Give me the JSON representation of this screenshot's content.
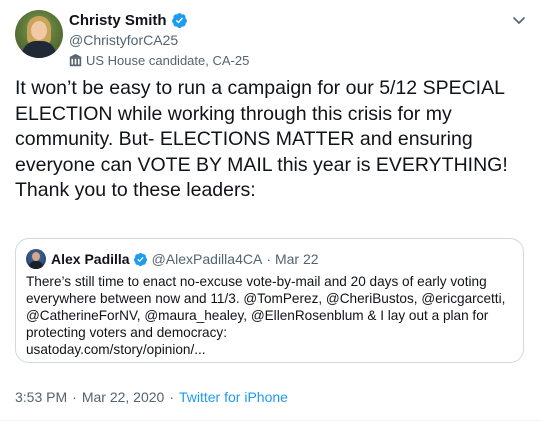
{
  "author": {
    "display_name": "Christy Smith",
    "handle": "@ChristyforCA25",
    "label": "US House candidate, CA-25",
    "verified": true
  },
  "tweet": {
    "lines": [
      "It won’t be easy to run a campaign for our 5/12 SPECIAL",
      "ELECTION while working through this crisis for my",
      "community.  But- ELECTIONS MATTER and ensuring",
      "everyone can VOTE BY MAIL this year is EVERYTHING!",
      "Thank you to these leaders:"
    ]
  },
  "quoted_tweet": {
    "display_name": "Alex Padilla",
    "handle": "@AlexPadilla4CA",
    "separator": "·",
    "date": "Mar 22",
    "verified": true,
    "lines": [
      "There’s still time to enact no-excuse vote-by-mail and 20 days of early voting",
      "everywhere between now and 11/3. @TomPerez, @CheriBustos, @ericgarcetti,",
      "@CatherineForNV, @maura_healey, @EllenRosenblum & I lay out a plan for",
      "protecting voters and democracy:",
      "usatoday.com/story/opinion/..."
    ]
  },
  "meta": {
    "time": "3:53 PM",
    "separator": "·",
    "date": "Mar 22, 2020",
    "source": "Twitter for iPhone"
  },
  "icons": {
    "verified": "verified-badge-icon",
    "label": "building-icon",
    "menu": "chevron-down-icon"
  },
  "colors": {
    "accent": "#1d9bf0",
    "text_primary": "#0f1419",
    "text_secondary": "#536471",
    "border": "#cfd9de"
  }
}
